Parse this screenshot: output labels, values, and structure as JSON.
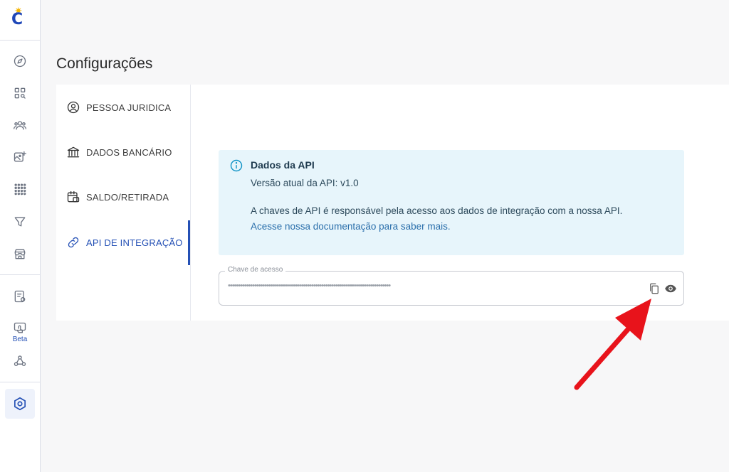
{
  "page_title": "Configurações",
  "sidebar": {
    "logo_letter": "C",
    "beta_label": "Beta",
    "icons": [
      "compass-icon",
      "apps-search-icon",
      "users-icon",
      "image-plus-icon",
      "grid-dots-icon",
      "filter-icon",
      "store-icon",
      "receipt-icon",
      "touch-screen-icon",
      "webhook-icon",
      "settings-icon"
    ]
  },
  "menu": {
    "items": [
      {
        "label": "PESSOA JURIDICA",
        "icon": "user-circle-icon"
      },
      {
        "label": "DADOS BANCÁRIO",
        "icon": "bank-icon"
      },
      {
        "label": "SALDO/RETIRADA",
        "icon": "wallet-calendar-icon"
      },
      {
        "label": "API DE INTEGRAÇÃO",
        "icon": "link-icon"
      }
    ],
    "active_index": 3
  },
  "info_box": {
    "title": "Dados da API",
    "version": "Versão atual da API: v1.0",
    "description": "A chaves de API é responsável pela acesso aos dados de integração com a nossa API.",
    "link_text": "Acesse nossa documentação para saber mais."
  },
  "access_key": {
    "label": "Chave de acesso",
    "masked_value": "••••••••••••••••••••••••••••••••••••••••••••••••••••••••••••••••••••••••••••••••",
    "copy_icon": "copy-icon",
    "reveal_icon": "eye-icon"
  },
  "colors": {
    "accent": "#2450b5",
    "info_bg": "#e7f5fb",
    "arrow": "#e8131b"
  }
}
